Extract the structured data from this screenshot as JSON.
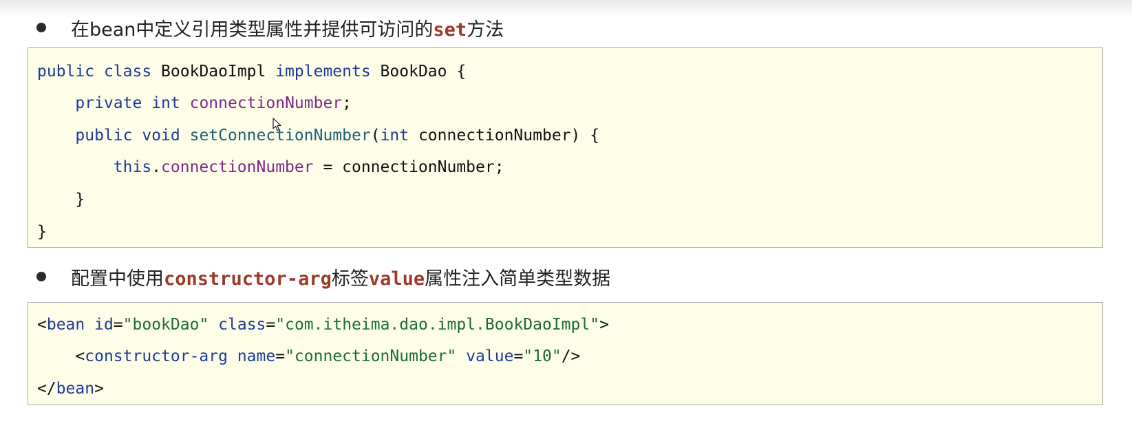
{
  "bullet1": {
    "prefix": "在bean中定义引用类型属性并提供可访问的",
    "keyword": "set",
    "suffix": "方法"
  },
  "code1": {
    "line1": {
      "t1": "public",
      "t2": " ",
      "t3": "class",
      "t4": " BookDaoImpl ",
      "t5": "implements",
      "t6": " BookDao {"
    },
    "line2": {
      "t1": "    ",
      "t2": "private",
      "t3": " ",
      "t4": "int",
      "t5": " ",
      "t6": "connectionNumber",
      "t7": ";"
    },
    "line3": {
      "t1": "    ",
      "t2": "public",
      "t3": " ",
      "t4": "void",
      "t5": " ",
      "t6": "setConnectionNumber",
      "t7": "(",
      "t8": "int",
      "t9": " connectionNumber) {"
    },
    "line4": {
      "t1": "        ",
      "t2": "this",
      "t3": ".",
      "t4": "connectionNumber",
      "t5": " = connectionNumber;"
    },
    "line5": {
      "t1": "    }"
    },
    "line6": {
      "t1": "}"
    }
  },
  "bullet2": {
    "prefix": "配置中使用",
    "keyword1": "constructor-arg",
    "middle": "标签",
    "keyword2": "value",
    "suffix": "属性注入简单类型数据"
  },
  "code2": {
    "line1": {
      "t1": "<",
      "t2": "bean",
      "t3": " ",
      "t4": "id",
      "t5": "=",
      "t6": "\"bookDao\"",
      "t7": " ",
      "t8": "class",
      "t9": "=",
      "t10": "\"com.itheima.dao.impl.BookDaoImpl\"",
      "t11": ">"
    },
    "line2": {
      "t1": "    <",
      "t2": "constructor-arg",
      "t3": " ",
      "t4": "name",
      "t5": "=",
      "t6": "\"connectionNumber\"",
      "t7": " ",
      "t8": "value",
      "t9": "=",
      "t10": "\"10\"",
      "t11": "/>"
    },
    "line3": {
      "t1": "</",
      "t2": "bean",
      "t3": ">"
    }
  }
}
